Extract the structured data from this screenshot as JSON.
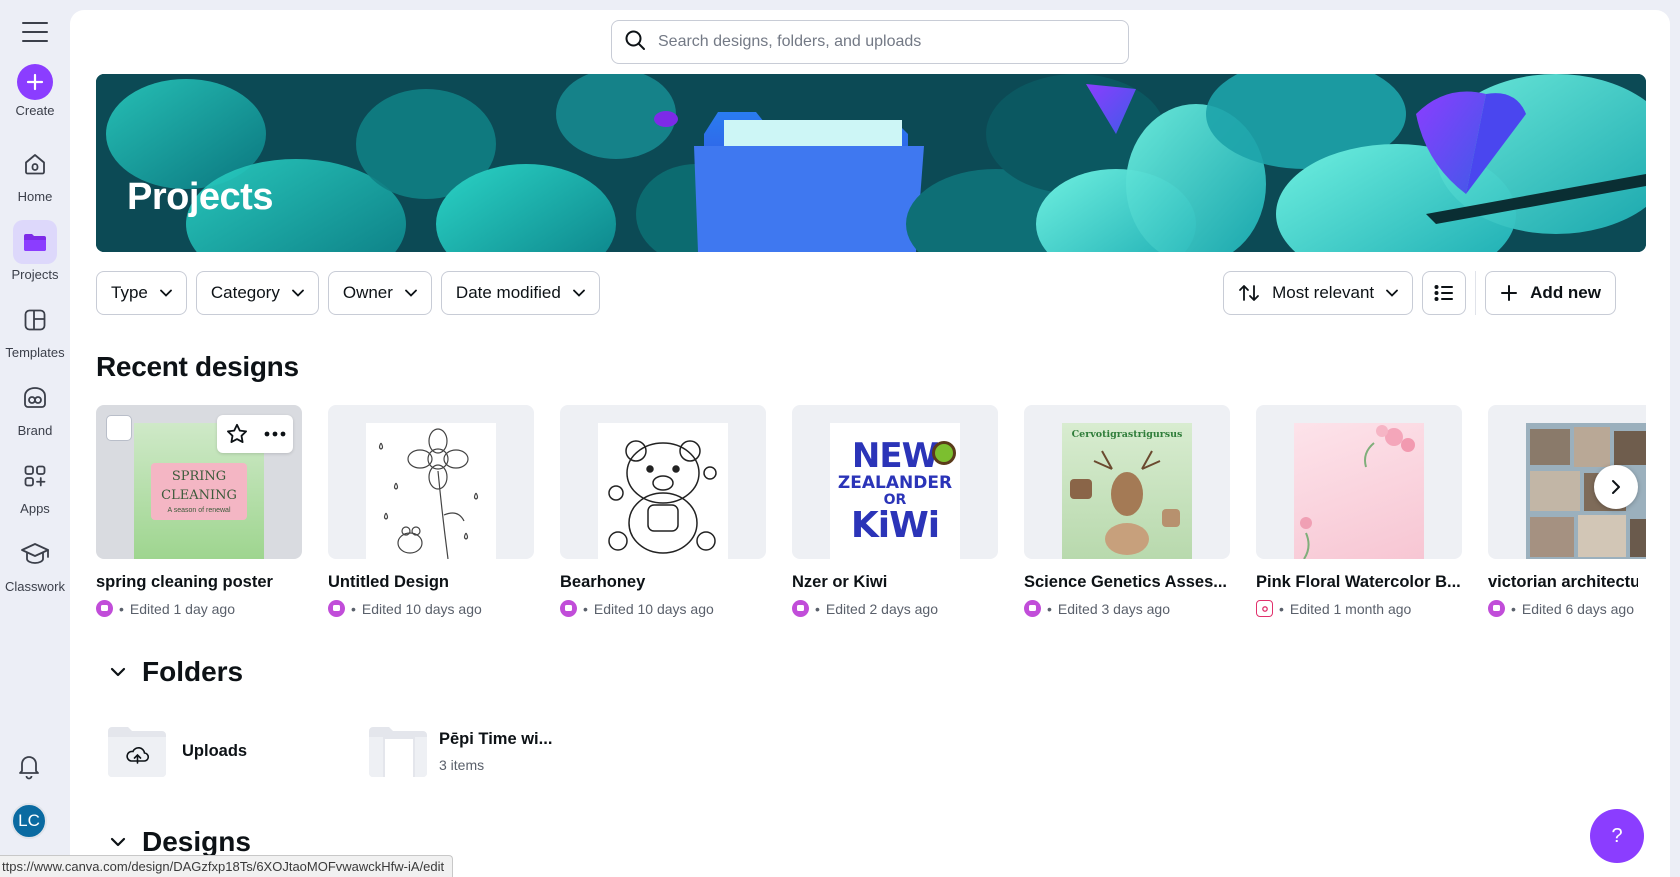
{
  "rail": {
    "create": "Create",
    "home": "Home",
    "projects": "Projects",
    "templates": "Templates",
    "brand": "Brand",
    "apps": "Apps",
    "classwork": "Classwork",
    "avatar_initials": "LC"
  },
  "search": {
    "placeholder": "Search designs, folders, and uploads"
  },
  "hero": {
    "title": "Projects"
  },
  "filters": [
    "Type",
    "Category",
    "Owner",
    "Date modified"
  ],
  "sort": {
    "label": "Most relevant"
  },
  "add_new": "Add new",
  "sections": {
    "recent": "Recent designs",
    "folders": "Folders",
    "designs": "Designs"
  },
  "recent_designs": [
    {
      "title": "spring cleaning poster",
      "meta": "Edited 1 day ago",
      "badge": "classwork",
      "thumb_text": [
        "SPRING",
        "CLEANING",
        "A season of renewal"
      ]
    },
    {
      "title": "Untitled Design",
      "meta": "Edited 10 days ago",
      "badge": "classwork"
    },
    {
      "title": "Bearhoney",
      "meta": "Edited 10 days ago",
      "badge": "classwork"
    },
    {
      "title": "Nzer or Kiwi",
      "meta": "Edited 2 days ago",
      "badge": "classwork",
      "thumb_text": [
        "NEW",
        "ZEALANDER",
        "OR",
        "KiWi"
      ]
    },
    {
      "title": "Science Genetics Asses...",
      "meta": "Edited 3 days ago",
      "badge": "classwork",
      "thumb_text": [
        "Cervotigrastrigursus"
      ]
    },
    {
      "title": "Pink Floral Watercolor B...",
      "meta": "Edited 1 month ago",
      "badge": "instagram"
    },
    {
      "title": "victorian architectu",
      "meta": "Edited 6 days ago",
      "badge": "classwork"
    }
  ],
  "folders": [
    {
      "name": "Uploads",
      "sub": ""
    },
    {
      "name": "Pēpi Time wi...",
      "sub": "3 items"
    }
  ],
  "help": "?",
  "status_url": "ttps://www.canva.com/design/DAGzfxp18Ts/6XOJtaoMOFvwawckHfw-iA/edit",
  "colors": {
    "brand": "#8b3dff",
    "hero": "#0c4d55",
    "avatar": "#0a6aa1"
  }
}
